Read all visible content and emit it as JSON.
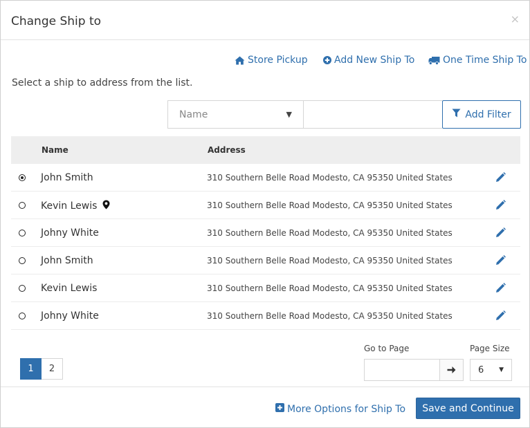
{
  "modal": {
    "title": "Change Ship to",
    "close_label": "×"
  },
  "actions": {
    "store_pickup": "Store Pickup",
    "add_new_ship_to": "Add New Ship To",
    "one_time_ship_to": "One Time Ship To"
  },
  "instruction": "Select a ship to address from the list.",
  "filter": {
    "field_selected": "Name",
    "value": "",
    "placeholder": "",
    "add_filter_label": "Add Filter"
  },
  "table": {
    "headers": {
      "name": "Name",
      "address": "Address"
    },
    "rows": [
      {
        "name": "John Smith",
        "address": "310 Southern Belle Road Modesto, CA 95350 United States",
        "selected": true,
        "has_location_pin": false
      },
      {
        "name": "Kevin Lewis",
        "address": "310 Southern Belle Road Modesto, CA 95350 United States",
        "selected": false,
        "has_location_pin": true
      },
      {
        "name": "Johny White",
        "address": "310 Southern Belle Road Modesto, CA 95350 United States",
        "selected": false,
        "has_location_pin": false
      },
      {
        "name": "John Smith",
        "address": "310 Southern Belle Road Modesto, CA 95350 United States",
        "selected": false,
        "has_location_pin": false
      },
      {
        "name": "Kevin Lewis",
        "address": "310 Southern Belle Road Modesto, CA 95350 United States",
        "selected": false,
        "has_location_pin": false
      },
      {
        "name": "Johny White",
        "address": "310 Southern Belle Road Modesto, CA 95350 United States",
        "selected": false,
        "has_location_pin": false
      }
    ]
  },
  "pagination": {
    "pages": [
      "1",
      "2"
    ],
    "active_page": "1",
    "go_to_page_label": "Go to Page",
    "go_to_page_value": "",
    "page_size_label": "Page Size",
    "page_size_value": "6"
  },
  "footer": {
    "more_options": "More Options for Ship To",
    "save_label": "Save and Continue"
  },
  "colors": {
    "accent": "#2f6fad",
    "header_bg": "#eeeeee",
    "border": "#d5d5d5"
  },
  "icons": {
    "store_pickup": "home-icon",
    "add_new": "plus-circle-icon",
    "one_time": "truck-icon",
    "filter": "filter-icon",
    "location": "map-marker-icon",
    "edit": "pencil-icon",
    "go": "arrow-right-icon",
    "more_options": "plus-square-icon",
    "close": "close-icon"
  }
}
